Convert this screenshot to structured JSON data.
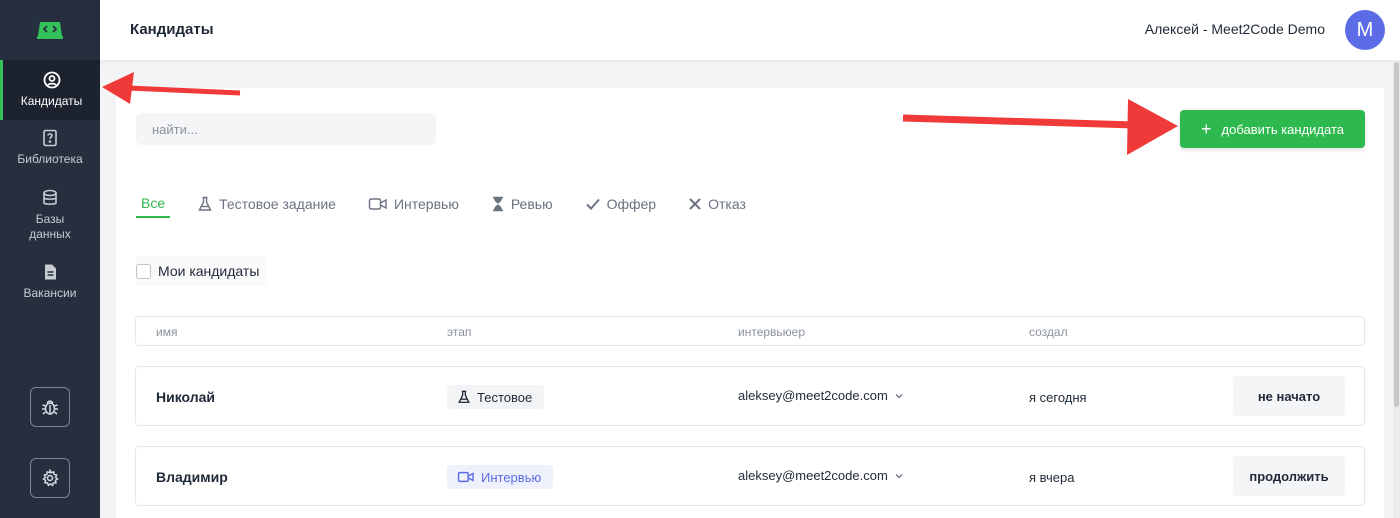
{
  "header": {
    "title": "Кандидаты",
    "user": "Алексей - Meet2Code Demo",
    "avatar_letter": "M"
  },
  "sidebar": {
    "items": [
      {
        "label": "Кандидаты",
        "icon": "user-circle-icon",
        "active": true
      },
      {
        "label": "Библиотека",
        "icon": "question-book-icon"
      },
      {
        "label": "Базы данных",
        "icon": "database-icon"
      },
      {
        "label": "Вакансии",
        "icon": "document-icon"
      }
    ],
    "bottom": [
      {
        "icon": "bug-icon"
      },
      {
        "icon": "gear-icon"
      }
    ]
  },
  "search": {
    "placeholder": "найти..."
  },
  "add_button": {
    "label": "добавить кандидата"
  },
  "tabs": [
    {
      "label": "Все",
      "icon": "",
      "active": true
    },
    {
      "label": "Тестовое задание",
      "icon": "flask-icon"
    },
    {
      "label": "Интервью",
      "icon": "video-icon"
    },
    {
      "label": "Ревью",
      "icon": "hourglass-icon"
    },
    {
      "label": "Оффер",
      "icon": "check-icon"
    },
    {
      "label": "Отказ",
      "icon": "x-icon"
    }
  ],
  "filter": {
    "my_candidates": "Мои кандидаты",
    "checked": false
  },
  "table": {
    "columns": [
      "имя",
      "этап",
      "интервьюер",
      "создал"
    ],
    "rows": [
      {
        "name": "Николай",
        "stage": "Тестовое",
        "stage_icon": "flask-icon",
        "interviewer": "aleksey@meet2code.com",
        "created": "я сегодня",
        "action": "не начато"
      },
      {
        "name": "Владимир",
        "stage": "Интервью",
        "stage_icon": "video-icon",
        "interviewer": "aleksey@meet2code.com",
        "created": "я вчера",
        "action": "продолжить"
      }
    ]
  },
  "colors": {
    "sidebar": "#262f3d",
    "accent": "#2eb94f",
    "avatar": "#5b6ce6",
    "interview": "#5b6ce6",
    "annotation": "#f03a3a"
  }
}
